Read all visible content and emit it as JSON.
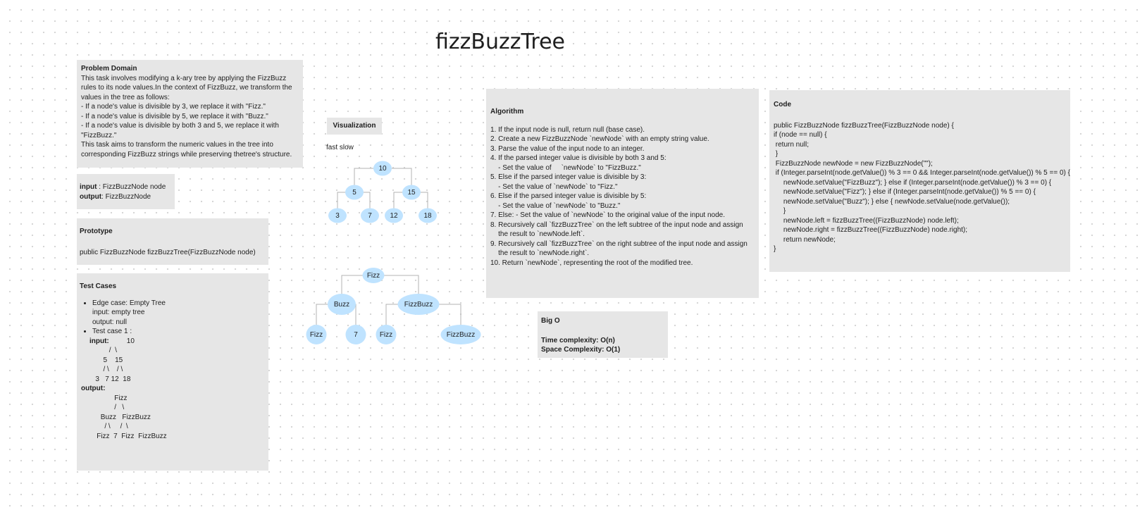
{
  "title": "fizzBuzzTree",
  "problem": {
    "heading": "Problem Domain",
    "lines": [
      "This task involves modifying a k-ary tree by applying the FizzBuzz",
      "rules to its node values.In the context of FizzBuzz, we transform the",
      "values in the tree as follows:",
      "- If a node's value is divisible by 3, we replace it with \"Fizz.\"",
      "- If a node's value is divisible by 5, we replace it with \"Buzz.\"",
      "- If a node's value is divisible by both 3 and 5, we replace it with",
      "\"FizzBuzz.\"",
      "This task aims to transform the numeric values in the tree into",
      "corresponding FizzBuzz strings while preserving thetree's structure."
    ]
  },
  "io": {
    "input_label": "input",
    "input_value": " : FizzBuzzNode node",
    "output_label": "output",
    "output_value": ": FizzBuzzNode"
  },
  "prototype": {
    "heading": "Prototype",
    "signature": "public FizzBuzzNode fizzBuzzTree(FizzBuzzNode node)"
  },
  "tests": {
    "heading": "Test Cases",
    "case1": "Edge case: Empty Tree",
    "case1_input": "input: empty tree",
    "case1_output": "output: null",
    "case2": "Test case 1 :",
    "input_label": "input:",
    "input_tree": "         10\n          /  \\\n       5    15\n       / \\    / \\\n   3   7 12  18",
    "output_label": "output:",
    "output_tree": "                 Fizz\n                 /   \\\n          Buzz   FizzBuzz\n            / \\     /  \\\n        Fizz  7  Fizz  FizzBuzz"
  },
  "visualization": {
    "label": "Visualization",
    "speed": "fast slow",
    "input_tree": {
      "nodes": [
        {
          "id": "a",
          "label": "10"
        },
        {
          "id": "b",
          "label": "5"
        },
        {
          "id": "c",
          "label": "15"
        },
        {
          "id": "d",
          "label": "3"
        },
        {
          "id": "e",
          "label": "7"
        },
        {
          "id": "f",
          "label": "12"
        },
        {
          "id": "g",
          "label": "18"
        }
      ],
      "edges": [
        [
          "a",
          "b"
        ],
        [
          "a",
          "c"
        ],
        [
          "b",
          "d"
        ],
        [
          "b",
          "e"
        ],
        [
          "c",
          "f"
        ],
        [
          "c",
          "g"
        ]
      ]
    },
    "output_tree": {
      "nodes": [
        {
          "id": "a",
          "label": "Fizz"
        },
        {
          "id": "b",
          "label": "Buzz"
        },
        {
          "id": "c",
          "label": "FizzBuzz"
        },
        {
          "id": "d",
          "label": "Fizz"
        },
        {
          "id": "e",
          "label": "7"
        },
        {
          "id": "f",
          "label": "Fizz"
        },
        {
          "id": "g",
          "label": "FizzBuzz"
        }
      ],
      "edges": [
        [
          "a",
          "b"
        ],
        [
          "a",
          "c"
        ],
        [
          "b",
          "d"
        ],
        [
          "b",
          "e"
        ],
        [
          "c",
          "f"
        ],
        [
          "c",
          "g"
        ]
      ]
    }
  },
  "algorithm": {
    "heading": "Algorithm",
    "lines": [
      "1. If the input node is null, return null (base case).",
      "2. Create a new FizzBuzzNode `newNode` with an empty string value.",
      "3. Parse the value of the input node to an integer.",
      "4. If the parsed integer value is divisible by both 3 and 5:",
      "    - Set the value of     `newNode` to \"FizzBuzz.\"",
      "5. Else if the parsed integer value is divisible by 3:",
      "    - Set the value of `newNode` to \"Fizz.\"",
      "6. Else if the parsed integer value is divisible by 5:",
      "    - Set the value of `newNode` to \"Buzz.\"",
      "7. Else: - Set the value of `newNode` to the original value of the input node.",
      "8. Recursively call `fizzBuzzTree` on the left subtree of the input node and assign",
      "    the result to `newNode.left`.",
      "9. Recursively call `fizzBuzzTree` on the right subtree of the input node and assign",
      "    the result to `newNode.right`.",
      "10. Return `newNode`, representing the root of the modified tree."
    ]
  },
  "bigo": {
    "heading": "Big O",
    "time": "Time complexity:  O(n)",
    "space": "Space Complexity: O(1)"
  },
  "code": {
    "heading": "Code",
    "lines": [
      "public FizzBuzzNode fizzBuzzTree(FizzBuzzNode node) {",
      "if (node == null) {",
      " return null;",
      " }",
      " FizzBuzzNode newNode = new FizzBuzzNode(\"\");",
      " if (Integer.parseInt(node.getValue()) % 3 == 0 && Integer.parseInt(node.getValue()) % 5 == 0) {",
      "     newNode.setValue(\"FizzBuzz\"); } else if (Integer.parseInt(node.getValue()) % 3 == 0) {",
      "     newNode.setValue(\"Fizz\"); } else if (Integer.parseInt(node.getValue()) % 5 == 0) {",
      "     newNode.setValue(\"Buzz\"); } else { newNode.setValue(node.getValue());",
      "     }",
      "     newNode.left = fizzBuzzTree((FizzBuzzNode) node.left);",
      "     newNode.right = fizzBuzzTree((FizzBuzzNode) node.right);",
      "     return newNode;",
      "}"
    ]
  }
}
